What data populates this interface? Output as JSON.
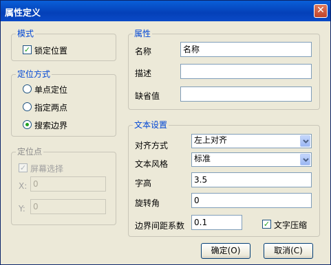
{
  "window": {
    "title": "属性定义",
    "close_glyph": "✕"
  },
  "mode": {
    "title": "模式",
    "lock_position": {
      "label": "锁定位置",
      "checked": true
    }
  },
  "positioning": {
    "title": "定位方式",
    "options": [
      {
        "label": "单点定位",
        "selected": false
      },
      {
        "label": "指定两点",
        "selected": false
      },
      {
        "label": "搜索边界",
        "selected": true
      }
    ]
  },
  "anchor": {
    "title": "定位点",
    "screen_pick": {
      "label": "屏幕选择",
      "checked": true,
      "disabled": true
    },
    "x_label": "X:",
    "x_value": "0",
    "y_label": "Y:",
    "y_value": "0"
  },
  "attribute": {
    "title": "属性",
    "name_label": "名称",
    "name_value": "名称",
    "desc_label": "描述",
    "desc_value": "",
    "default_label": "缺省值",
    "default_value": ""
  },
  "text_settings": {
    "title": "文本设置",
    "align_label": "对齐方式",
    "align_value": "左上对齐",
    "style_label": "文本风格",
    "style_value": "标准",
    "height_label": "字高",
    "height_value": "3.5",
    "rotation_label": "旋转角",
    "rotation_value": "0",
    "margin_label": "边界间距系数",
    "margin_value": "0.1",
    "compress": {
      "label": "文字压缩",
      "checked": true
    }
  },
  "buttons": {
    "ok": "确定(O)",
    "cancel": "取消(C)"
  },
  "colors": {
    "title_bar": "#0a50c8",
    "group_label": "#0046d5",
    "check_mark": "#21a121"
  },
  "icons": {
    "close": "close-icon",
    "dropdown": "chevron-down-icon"
  }
}
